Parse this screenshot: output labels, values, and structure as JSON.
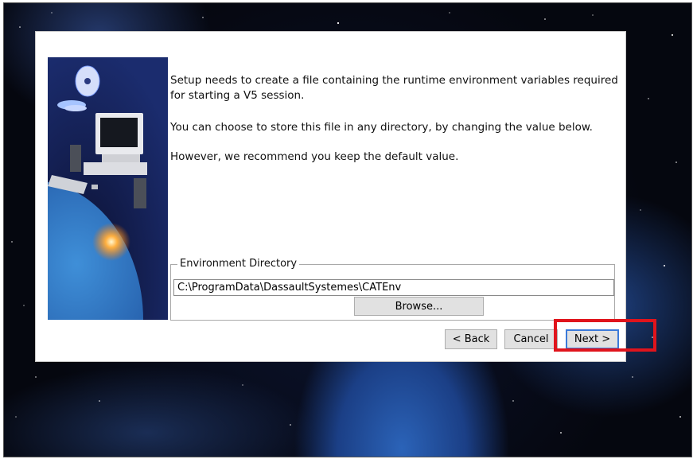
{
  "dialog": {
    "message_line1": "Setup needs to create a file containing the runtime environment variables required for starting a V5 session.",
    "message_line2": "You can choose to store this file in any directory, by changing the value below.",
    "message_line3": "However, we recommend you keep the default value.",
    "group_title": "Environment Directory",
    "directory_value": "C:\\ProgramData\\DassaultSystemes\\CATEnv",
    "browse_label": "Browse...",
    "back_label": "< Back",
    "cancel_label": "Cancel",
    "next_label": "Next >"
  },
  "colors": {
    "highlight": "#e0141c",
    "default_button_border": "#3b7ad9"
  },
  "icons": {
    "side_image": "computer-with-cds-and-planet-illustration"
  }
}
